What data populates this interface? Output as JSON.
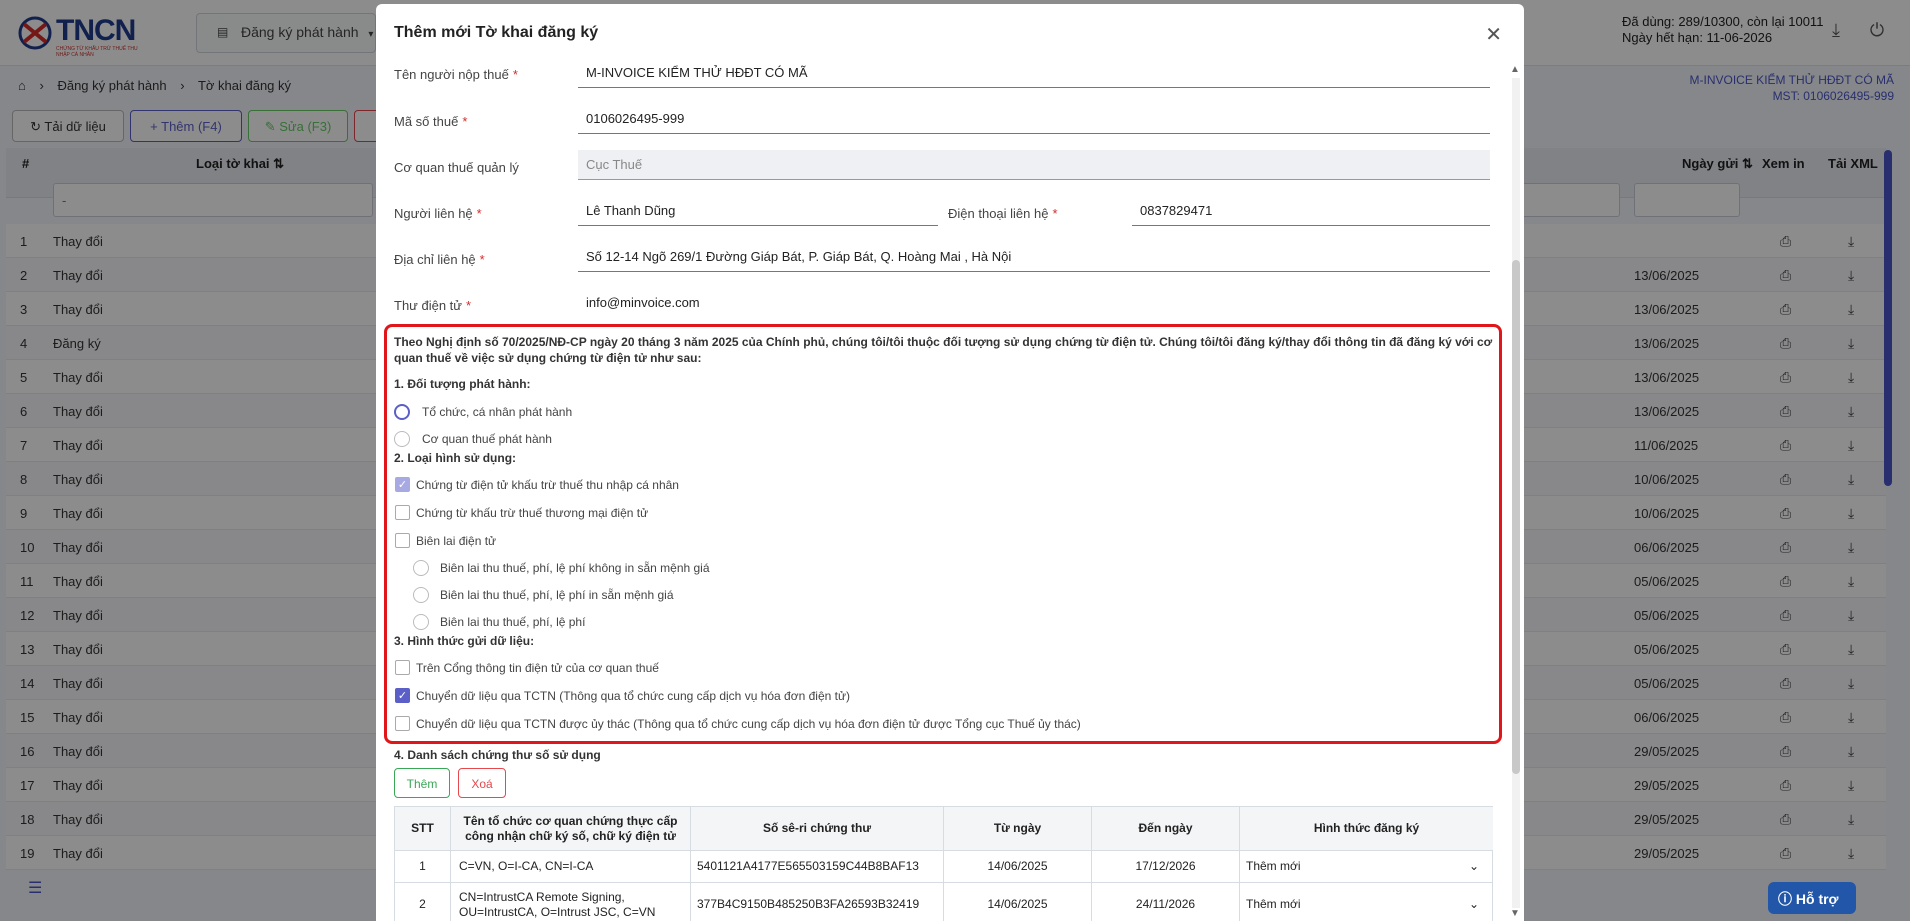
{
  "header": {
    "logo_text": "TNCN",
    "logo_sub": "CHỨNG TỪ KHẤU TRỪ THUẾ THU NHẬP CÁ NHÂN",
    "nav_label": "Đăng ký phát hành",
    "usage_line1": "Đã dùng: 289/10300, còn lại 10011",
    "usage_line2": "Ngày hết hạn: 11-06-2026"
  },
  "breadcrumb": {
    "level1": "Đăng ký phát hành",
    "level2": "Tờ khai đăng ký"
  },
  "company": {
    "name": "M-INVOICE KIỂM THỬ HĐĐT CÓ MÃ",
    "mst": "MST: 0106026495-999"
  },
  "toolbar": {
    "reload": "Tải dữ liệu",
    "add": "Thêm (F4)",
    "edit": "Sửa (F3)"
  },
  "grid": {
    "headers": {
      "num": "#",
      "type": "Loại tờ khai",
      "sent_date": "Ngày gửi",
      "print": "Xem in",
      "xml": "Tải XML"
    },
    "filter_placeholder": "-",
    "rows": [
      {
        "n": "1",
        "type": "Thay đổi",
        "date": ""
      },
      {
        "n": "2",
        "type": "Thay đổi",
        "date": "13/06/2025"
      },
      {
        "n": "3",
        "type": "Thay đổi",
        "date": "13/06/2025"
      },
      {
        "n": "4",
        "type": "Đăng ký",
        "date": "13/06/2025"
      },
      {
        "n": "5",
        "type": "Thay đổi",
        "date": "13/06/2025"
      },
      {
        "n": "6",
        "type": "Thay đổi",
        "date": "13/06/2025"
      },
      {
        "n": "7",
        "type": "Thay đổi",
        "date": "11/06/2025"
      },
      {
        "n": "8",
        "type": "Thay đổi",
        "date": "10/06/2025"
      },
      {
        "n": "9",
        "type": "Thay đổi",
        "date": "10/06/2025"
      },
      {
        "n": "10",
        "type": "Thay đổi",
        "date": "06/06/2025"
      },
      {
        "n": "11",
        "type": "Thay đổi",
        "date": "05/06/2025"
      },
      {
        "n": "12",
        "type": "Thay đổi",
        "date": "05/06/2025"
      },
      {
        "n": "13",
        "type": "Thay đổi",
        "date": "05/06/2025"
      },
      {
        "n": "14",
        "type": "Thay đổi",
        "date": "05/06/2025"
      },
      {
        "n": "15",
        "type": "Thay đổi",
        "date": "06/06/2025"
      },
      {
        "n": "16",
        "type": "Thay đổi",
        "date": "29/05/2025"
      },
      {
        "n": "17",
        "type": "Thay đổi",
        "date": "29/05/2025"
      },
      {
        "n": "18",
        "type": "Thay đổi",
        "date": "29/05/2025"
      },
      {
        "n": "19",
        "type": "Thay đổi",
        "date": "29/05/2025"
      }
    ]
  },
  "modal": {
    "title": "Thêm mới Tờ khai đăng ký",
    "fields": {
      "taxpayer_label": "Tên người nộp thuế",
      "taxpayer_value": "M-INVOICE KIỂM THỬ HĐĐT CÓ MÃ",
      "taxcode_label": "Mã số thuế",
      "taxcode_value": "0106026495-999",
      "taxoffice_label": "Cơ quan thuế quản lý",
      "taxoffice_value": "Cục Thuế",
      "contact_label": "Người liên hệ",
      "contact_value": "Lê Thanh Dũng",
      "phone_label": "Điện thoại liên hệ",
      "phone_value": "0837829471",
      "address_label": "Địa chỉ liên hệ",
      "address_value": "Số 12-14 Ngõ 269/1 Đường Giáp Bát, P. Giáp Bát, Q. Hoàng Mai , Hà Nội",
      "email_label": "Thư điện tử",
      "email_value": "info@minvoice.com",
      "required_mark": "*"
    },
    "intro": "Theo Nghị định số 70/2025/NĐ-CP ngày 20 tháng 3 năm 2025 của Chính phủ, chúng tôi/tôi thuộc đối tượng sử dụng chứng từ điện tử. Chúng tôi/tôi đăng ký/thay đổi thông tin đã đăng ký với cơ quan thuế về việc sử dụng chứng từ điện tử như sau:",
    "section1": {
      "title": "1. Đối tượng phát hành:",
      "opt1": "Tổ chức, cá nhân phát hành",
      "opt2": "Cơ quan thuế phát hành"
    },
    "section2": {
      "title": "2. Loại hình sử dụng:",
      "opt1": "Chứng từ điện tử khấu trừ thuế thu nhập cá nhân",
      "opt2": "Chứng từ khấu trừ thuế thương mại điện tử",
      "opt3": "Biên lai điện tử",
      "sub1": "Biên lai thu thuế, phí, lệ phí không in sẵn mệnh giá",
      "sub2": "Biên lai thu thuế, phí, lệ phí in sẵn mệnh giá",
      "sub3": "Biên lai thu thuế, phí, lệ phí"
    },
    "section3": {
      "title": "3. Hình thức gửi dữ liệu:",
      "opt1": "Trên Cổng thông tin điện tử của cơ quan thuế",
      "opt2": "Chuyển dữ liệu qua TCTN (Thông qua tổ chức cung cấp dịch vụ hóa đơn điện tử)",
      "opt3": "Chuyển dữ liệu qua TCTN được ủy thác (Thông qua tổ chức cung cấp dịch vụ hóa đơn điện tử được Tổng cục Thuế ủy thác)"
    },
    "section4": {
      "title": "4. Danh sách chứng thư số sử dụng",
      "add": "Thêm",
      "delete": "Xoá",
      "headers": {
        "stt": "STT",
        "org": "Tên tổ chức cơ quan chứng thực cấp công nhận chữ ký số, chữ ký điện tử",
        "serial": "Số sê-ri chứng thư",
        "from": "Từ ngày",
        "to": "Đến ngày",
        "form": "Hình thức đăng ký"
      },
      "rows": [
        {
          "stt": "1",
          "org": "C=VN, O=I-CA, CN=I-CA",
          "serial": "5401121A4177E565503159C44B8BAF13",
          "from": "14/06/2025",
          "to": "17/12/2026",
          "form": "Thêm mới"
        },
        {
          "stt": "2",
          "org": "CN=IntrustCA Remote Signing, OU=IntrustCA, O=Intrust JSC, C=VN",
          "serial": "377B4C9150B485250B3FA26593B32419",
          "from": "14/06/2025",
          "to": "24/11/2026",
          "form": "Thêm mới"
        }
      ]
    }
  },
  "help_label": "Hỗ trợ",
  "colors": {
    "accent": "#5b5fc7",
    "highlight_box": "#e0161b",
    "brand": "#1f3b8c"
  }
}
